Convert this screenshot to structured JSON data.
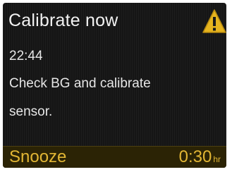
{
  "alert": {
    "title": "Calibrate now",
    "time": "22:44",
    "message_line1": "Check BG and calibrate",
    "message_line2": "sensor.",
    "icon": "warning-triangle-icon"
  },
  "footer": {
    "softkey_label": "Snooze",
    "duration_value": "0:30",
    "duration_unit": "hr"
  },
  "colors": {
    "screen_background": "#151515",
    "text": "#f2f2f2",
    "accent": "#e2b634",
    "footer_background": "#2b2305",
    "warning_yellow": "#e6b41e"
  }
}
